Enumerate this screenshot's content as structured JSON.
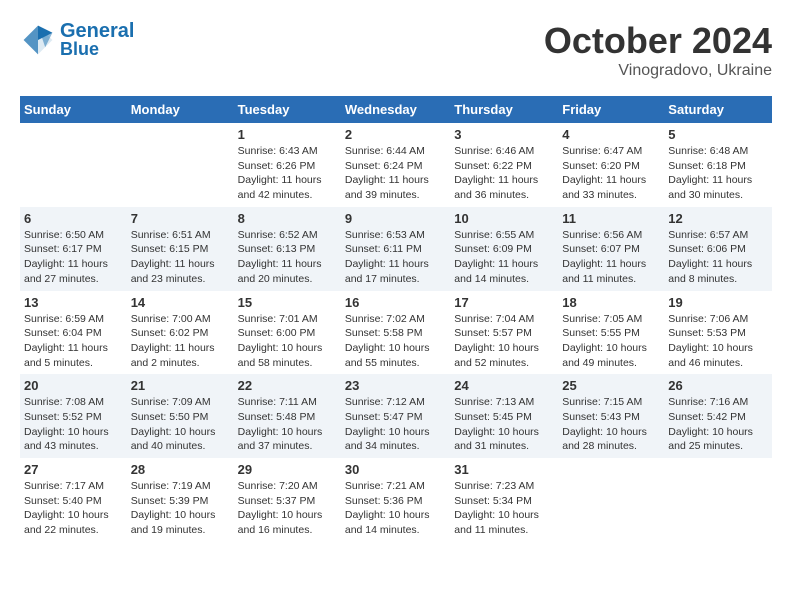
{
  "header": {
    "logo_line1": "General",
    "logo_line2": "Blue",
    "month": "October 2024",
    "location": "Vinogradovo, Ukraine"
  },
  "days_of_week": [
    "Sunday",
    "Monday",
    "Tuesday",
    "Wednesday",
    "Thursday",
    "Friday",
    "Saturday"
  ],
  "weeks": [
    [
      {
        "day": "",
        "info": ""
      },
      {
        "day": "",
        "info": ""
      },
      {
        "day": "1",
        "info": "Sunrise: 6:43 AM\nSunset: 6:26 PM\nDaylight: 11 hours and 42 minutes."
      },
      {
        "day": "2",
        "info": "Sunrise: 6:44 AM\nSunset: 6:24 PM\nDaylight: 11 hours and 39 minutes."
      },
      {
        "day": "3",
        "info": "Sunrise: 6:46 AM\nSunset: 6:22 PM\nDaylight: 11 hours and 36 minutes."
      },
      {
        "day": "4",
        "info": "Sunrise: 6:47 AM\nSunset: 6:20 PM\nDaylight: 11 hours and 33 minutes."
      },
      {
        "day": "5",
        "info": "Sunrise: 6:48 AM\nSunset: 6:18 PM\nDaylight: 11 hours and 30 minutes."
      }
    ],
    [
      {
        "day": "6",
        "info": "Sunrise: 6:50 AM\nSunset: 6:17 PM\nDaylight: 11 hours and 27 minutes."
      },
      {
        "day": "7",
        "info": "Sunrise: 6:51 AM\nSunset: 6:15 PM\nDaylight: 11 hours and 23 minutes."
      },
      {
        "day": "8",
        "info": "Sunrise: 6:52 AM\nSunset: 6:13 PM\nDaylight: 11 hours and 20 minutes."
      },
      {
        "day": "9",
        "info": "Sunrise: 6:53 AM\nSunset: 6:11 PM\nDaylight: 11 hours and 17 minutes."
      },
      {
        "day": "10",
        "info": "Sunrise: 6:55 AM\nSunset: 6:09 PM\nDaylight: 11 hours and 14 minutes."
      },
      {
        "day": "11",
        "info": "Sunrise: 6:56 AM\nSunset: 6:07 PM\nDaylight: 11 hours and 11 minutes."
      },
      {
        "day": "12",
        "info": "Sunrise: 6:57 AM\nSunset: 6:06 PM\nDaylight: 11 hours and 8 minutes."
      }
    ],
    [
      {
        "day": "13",
        "info": "Sunrise: 6:59 AM\nSunset: 6:04 PM\nDaylight: 11 hours and 5 minutes."
      },
      {
        "day": "14",
        "info": "Sunrise: 7:00 AM\nSunset: 6:02 PM\nDaylight: 11 hours and 2 minutes."
      },
      {
        "day": "15",
        "info": "Sunrise: 7:01 AM\nSunset: 6:00 PM\nDaylight: 10 hours and 58 minutes."
      },
      {
        "day": "16",
        "info": "Sunrise: 7:02 AM\nSunset: 5:58 PM\nDaylight: 10 hours and 55 minutes."
      },
      {
        "day": "17",
        "info": "Sunrise: 7:04 AM\nSunset: 5:57 PM\nDaylight: 10 hours and 52 minutes."
      },
      {
        "day": "18",
        "info": "Sunrise: 7:05 AM\nSunset: 5:55 PM\nDaylight: 10 hours and 49 minutes."
      },
      {
        "day": "19",
        "info": "Sunrise: 7:06 AM\nSunset: 5:53 PM\nDaylight: 10 hours and 46 minutes."
      }
    ],
    [
      {
        "day": "20",
        "info": "Sunrise: 7:08 AM\nSunset: 5:52 PM\nDaylight: 10 hours and 43 minutes."
      },
      {
        "day": "21",
        "info": "Sunrise: 7:09 AM\nSunset: 5:50 PM\nDaylight: 10 hours and 40 minutes."
      },
      {
        "day": "22",
        "info": "Sunrise: 7:11 AM\nSunset: 5:48 PM\nDaylight: 10 hours and 37 minutes."
      },
      {
        "day": "23",
        "info": "Sunrise: 7:12 AM\nSunset: 5:47 PM\nDaylight: 10 hours and 34 minutes."
      },
      {
        "day": "24",
        "info": "Sunrise: 7:13 AM\nSunset: 5:45 PM\nDaylight: 10 hours and 31 minutes."
      },
      {
        "day": "25",
        "info": "Sunrise: 7:15 AM\nSunset: 5:43 PM\nDaylight: 10 hours and 28 minutes."
      },
      {
        "day": "26",
        "info": "Sunrise: 7:16 AM\nSunset: 5:42 PM\nDaylight: 10 hours and 25 minutes."
      }
    ],
    [
      {
        "day": "27",
        "info": "Sunrise: 7:17 AM\nSunset: 5:40 PM\nDaylight: 10 hours and 22 minutes."
      },
      {
        "day": "28",
        "info": "Sunrise: 7:19 AM\nSunset: 5:39 PM\nDaylight: 10 hours and 19 minutes."
      },
      {
        "day": "29",
        "info": "Sunrise: 7:20 AM\nSunset: 5:37 PM\nDaylight: 10 hours and 16 minutes."
      },
      {
        "day": "30",
        "info": "Sunrise: 7:21 AM\nSunset: 5:36 PM\nDaylight: 10 hours and 14 minutes."
      },
      {
        "day": "31",
        "info": "Sunrise: 7:23 AM\nSunset: 5:34 PM\nDaylight: 10 hours and 11 minutes."
      },
      {
        "day": "",
        "info": ""
      },
      {
        "day": "",
        "info": ""
      }
    ]
  ]
}
